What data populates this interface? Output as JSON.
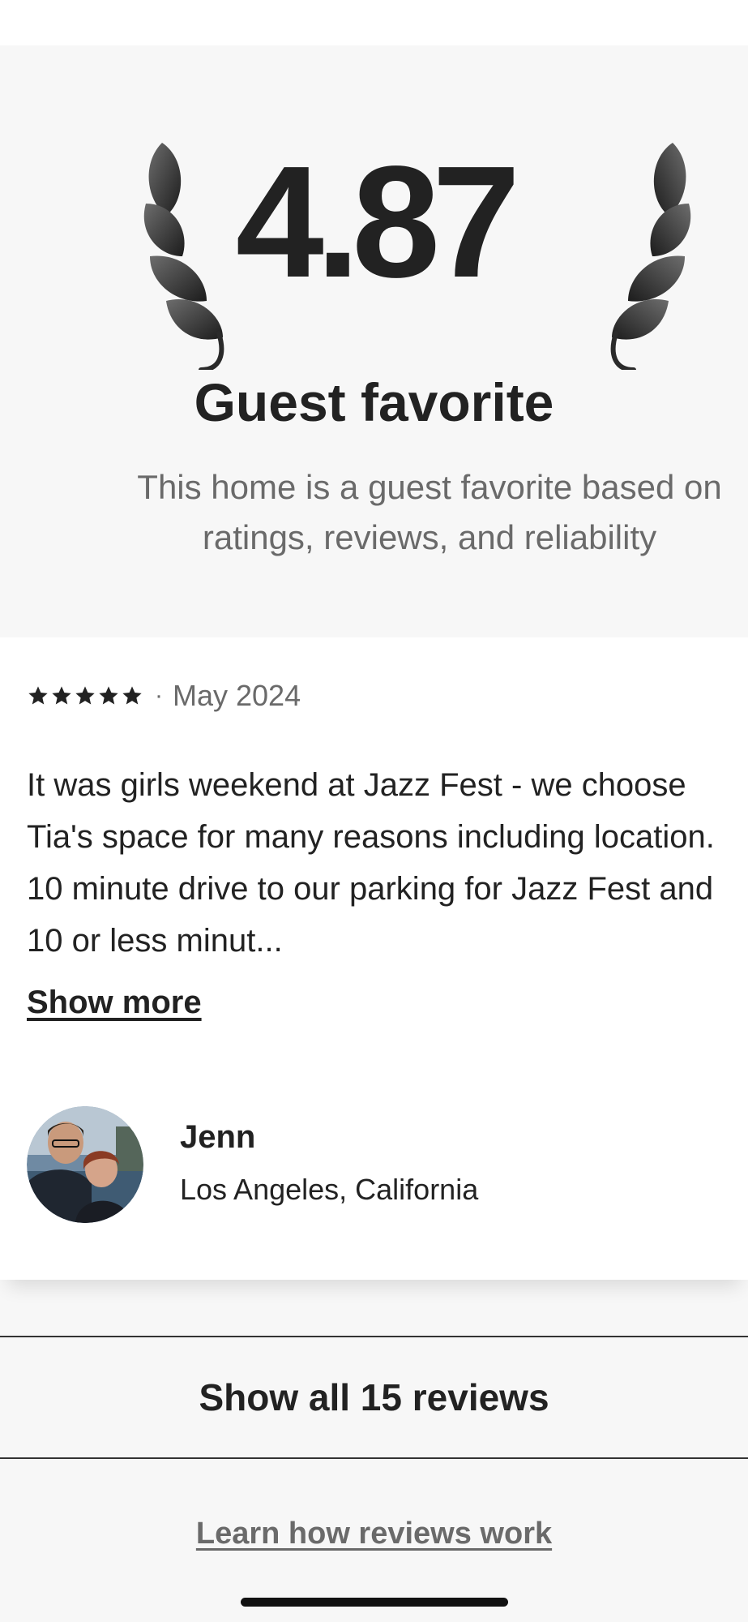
{
  "guest_favorite": {
    "rating": "4.87",
    "title": "Guest favorite",
    "subtitle": "This home is a guest favorite based on ratings, reviews, and reliability"
  },
  "review": {
    "stars": 5,
    "separator": "·",
    "date": "May 2024",
    "text": "It was girls weekend at Jazz Fest - we choose Tia's space for many reasons including location. 10 minute drive to our parking for Jazz Fest and 10 or less minut...",
    "show_more_label": "Show more",
    "reviewer": {
      "name": "Jenn",
      "location": "Los Angeles, California"
    }
  },
  "actions": {
    "show_all_label": "Show all 15 reviews",
    "learn_label": "Learn how reviews work"
  },
  "icons": {
    "laurel": "laurel-icon",
    "star": "star-icon"
  },
  "colors": {
    "text_primary": "#222222",
    "text_secondary": "#6a6a6a",
    "background": "#f7f7f7",
    "card": "#ffffff"
  }
}
